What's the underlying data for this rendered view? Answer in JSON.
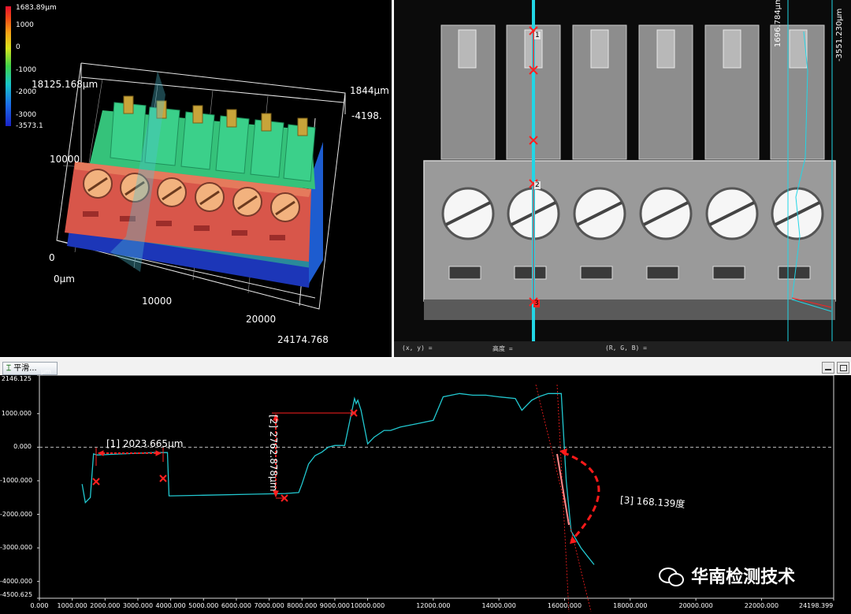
{
  "view3d": {
    "colorbar_labels": [
      "1683.89μm",
      "1000",
      "0",
      "-1000",
      "-2000",
      "-3000",
      "-3573.1"
    ],
    "y_top_label": "18125.168μm",
    "y_mid_label": "10000",
    "y_zero_label": "0",
    "origin_label": "0μm",
    "x_mid_label": "10000",
    "x_far_label": "20000",
    "x_end_label": "24174.768",
    "z_top_label": "1844μm",
    "z_bottom_label": "-4198."
  },
  "view2d": {
    "marker_labels": [
      "1",
      "2",
      "3"
    ],
    "right_dim_1": "1696.784μm",
    "right_dim_2": "-3551.230μm",
    "status": [
      "(x, y) =",
      "高度 =",
      "(R, G, B) ="
    ]
  },
  "profile": {
    "smooth_button": "平滑...",
    "unit": "μm",
    "measurements": [
      {
        "label": "[1]  2023.665μm"
      },
      {
        "label": "[2]  2762.878μm"
      },
      {
        "label": "[3]  168.139度"
      }
    ],
    "watermark": "华南检测技术",
    "colors": {
      "profile_line": "#22c8d0",
      "measure": "#ff2020",
      "angle_arc": "#ff1a1a"
    }
  },
  "chart_data": {
    "type": "line",
    "ylabel": "μm",
    "ylim": [
      -4500.625,
      2146.125
    ],
    "xlim": [
      0,
      24198.399
    ],
    "y_ticks": [
      "2146.125",
      "1000.000",
      "0.000",
      "-1000.000",
      "-2000.000",
      "-3000.000",
      "-4000.000",
      "-4500.625"
    ],
    "y_tick_values": [
      2146.125,
      1000,
      0,
      -1000,
      -2000,
      -3000,
      -4000,
      -4500.625
    ],
    "x_ticks": [
      "0.000",
      "1000.000",
      "2000.000",
      "3000.000",
      "4000.000",
      "5000.000",
      "6000.000",
      "7000.000",
      "8000.000",
      "9000.000",
      "10000.000",
      "12000.000",
      "14000.000",
      "16000.000",
      "18000.000",
      "20000.000",
      "22000.000",
      "24198.399"
    ],
    "x_tick_values": [
      0,
      1000,
      2000,
      3000,
      4000,
      5000,
      6000,
      7000,
      8000,
      9000,
      10000,
      12000,
      14000,
      16000,
      18000,
      20000,
      22000,
      24198.399
    ],
    "series": [
      {
        "x": [
          1300,
          1400,
          1550,
          1650,
          1750,
          1800,
          2500,
          3500,
          3900,
          3950,
          4000,
          5000,
          6500,
          7500,
          7900,
          8000,
          8200,
          8400,
          8600,
          8800,
          9000,
          9300,
          9600,
          9650,
          9700,
          9800,
          10000,
          10200,
          10500,
          10700,
          11000,
          11500,
          12000,
          12300,
          12800,
          13200,
          13600,
          14000,
          14500,
          14700,
          15000,
          15200,
          15500,
          15900,
          16050,
          16200,
          16500,
          16700,
          16900
        ],
        "y": [
          -1100,
          -1650,
          -1500,
          -200,
          -230,
          -230,
          -200,
          -160,
          -160,
          -1450,
          -1450,
          -1430,
          -1400,
          -1380,
          -1350,
          -1100,
          -500,
          -250,
          -150,
          0,
          50,
          50,
          1450,
          1300,
          1400,
          1100,
          100,
          300,
          500,
          500,
          600,
          700,
          800,
          1500,
          1600,
          1550,
          1550,
          1500,
          1450,
          1100,
          1400,
          1500,
          1600,
          1600,
          -1000,
          -2500,
          -3000,
          -3250,
          -3500
        ]
      }
    ]
  }
}
